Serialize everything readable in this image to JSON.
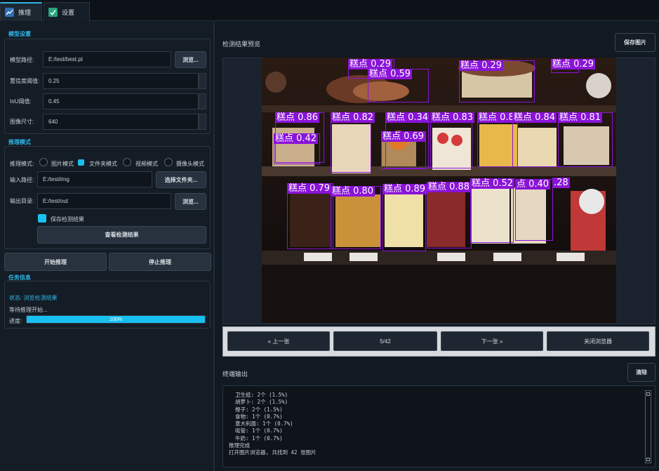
{
  "tabs": [
    {
      "label": "推理",
      "icon": "chart-line-icon",
      "active": true
    },
    {
      "label": "设置",
      "icon": "checkbox-settings-icon",
      "active": false
    }
  ],
  "model_settings": {
    "title": "模型设置",
    "model_path_label": "模型路径:",
    "model_path_value": "E:/test/best.pt",
    "browse_label": "浏览...",
    "conf_label": "置信度阈值:",
    "conf_value": "0.25",
    "iou_label": "IoU阈值:",
    "iou_value": "0.45",
    "imgsz_label": "图像尺寸:",
    "imgsz_value": "640"
  },
  "inference_mode": {
    "title": "推理模式",
    "mode_label": "推理模式:",
    "options": [
      "图片模式",
      "文件夹模式",
      "视频模式",
      "摄像头模式"
    ],
    "selected": "文件夹模式",
    "input_label": "输入路径:",
    "input_value": "E:/test/img",
    "select_folder_label": "选择文件夹...",
    "output_label": "输出目录:",
    "output_value": "E:/test/out",
    "browse_label": "浏览...",
    "save_results_label": "保存检测结果",
    "view_results_label": "查看检测结果"
  },
  "actions": {
    "start_label": "开始推理",
    "stop_label": "停止推理"
  },
  "task_info": {
    "title": "任务信息",
    "status": "状态: 浏览检测结果",
    "message": "等待推理开始...",
    "progress_label": "进度:",
    "progress_text": "100%",
    "progress_value": 100
  },
  "preview": {
    "title": "检测结果预览",
    "save_image_label": "保存图片",
    "detections": [
      {
        "label": "糕点 0.29"
      },
      {
        "label": "糕点 0.59"
      },
      {
        "label": "糕点 0.29"
      },
      {
        "label": "糕点 0.29"
      },
      {
        "label": "糕点 0.86"
      },
      {
        "label": "糕点 0.82"
      },
      {
        "label": "糕点 0.34"
      },
      {
        "label": "糕点 0.83"
      },
      {
        "label": "糕点 0.8"
      },
      {
        "label": "糕点 0.84"
      },
      {
        "label": "糕点 0.81"
      },
      {
        "label": "糕点 0.42"
      },
      {
        "label": "糕点 0.69"
      },
      {
        "label": "糕点 0.79"
      },
      {
        "label": "糕点 0.80"
      },
      {
        "label": "糕点 0.89"
      },
      {
        "label": "糕点 0.88"
      },
      {
        "label": "糕点 0.52"
      },
      {
        "label": "点 0.40"
      },
      {
        "label": ".28"
      }
    ]
  },
  "navigation": {
    "prev_label": "« 上一张",
    "counter": "5/42",
    "next_label": "下一张 »",
    "close_label": "关闭浏览器"
  },
  "terminal": {
    "title": "终端输出",
    "clear_label": "清除",
    "lines": [
      "  卫生纸: 2个 (1.5%)",
      "  胡萝卜: 2个 (1.5%)",
      "  橙子: 2个 (1.5%)",
      "  食物: 1个 (0.7%)",
      "  意大利面: 1个 (0.7%)",
      "  吸管: 1个 (0.7%)",
      "  牛奶: 1个 (0.7%)",
      "推理完成",
      "打开图片浏览器, 共找到 42 张图片"
    ]
  },
  "colors": {
    "accent": "#18c0f0",
    "detection_box": "#8a13d8",
    "background": "#111922"
  }
}
